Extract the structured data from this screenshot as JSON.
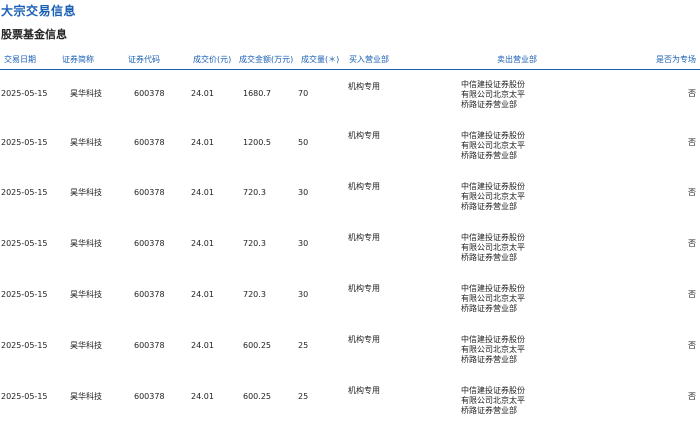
{
  "page_title": "大宗交易信息",
  "section_title": "股票基金信息",
  "columns": {
    "date": "交易日期",
    "name": "证券简称",
    "code": "证券代码",
    "price": "成交价(元)",
    "amount": "成交金额(万元)",
    "volume": "成交量(＊)",
    "buyer": "买入营业部",
    "seller": "卖出营业部",
    "special": "是否为专场"
  },
  "rows": [
    {
      "date": "2025-05-15",
      "name": "昊华科技",
      "code": "600378",
      "price": "24.01",
      "amount": "1680.7",
      "volume": "70",
      "buyer": "机构专用",
      "seller": "中信建投证券股份有限公司北京太平桥路证券营业部",
      "special": "否"
    },
    {
      "date": "2025-05-15",
      "name": "昊华科技",
      "code": "600378",
      "price": "24.01",
      "amount": "1200.5",
      "volume": "50",
      "buyer": "机构专用",
      "seller": "中信建投证券股份有限公司北京太平桥路证券营业部",
      "special": "否"
    },
    {
      "date": "2025-05-15",
      "name": "昊华科技",
      "code": "600378",
      "price": "24.01",
      "amount": "720.3",
      "volume": "30",
      "buyer": "机构专用",
      "seller": "中信建投证券股份有限公司北京太平桥路证券营业部",
      "special": "否"
    },
    {
      "date": "2025-05-15",
      "name": "昊华科技",
      "code": "600378",
      "price": "24.01",
      "amount": "720.3",
      "volume": "30",
      "buyer": "机构专用",
      "seller": "中信建投证券股份有限公司北京太平桥路证券营业部",
      "special": "否"
    },
    {
      "date": "2025-05-15",
      "name": "昊华科技",
      "code": "600378",
      "price": "24.01",
      "amount": "720.3",
      "volume": "30",
      "buyer": "机构专用",
      "seller": "中信建投证券股份有限公司北京太平桥路证券营业部",
      "special": "否"
    },
    {
      "date": "2025-05-15",
      "name": "昊华科技",
      "code": "600378",
      "price": "24.01",
      "amount": "600.25",
      "volume": "25",
      "buyer": "机构专用",
      "seller": "中信建投证券股份有限公司北京太平桥路证券营业部",
      "special": "否"
    },
    {
      "date": "2025-05-15",
      "name": "昊华科技",
      "code": "600378",
      "price": "24.01",
      "amount": "600.25",
      "volume": "25",
      "buyer": "机构专用",
      "seller": "中信建投证券股份有限公司北京太平桥路证券营业部",
      "special": "否"
    }
  ],
  "colors": {
    "accent": "#1a5fb4",
    "text": "#222222"
  }
}
